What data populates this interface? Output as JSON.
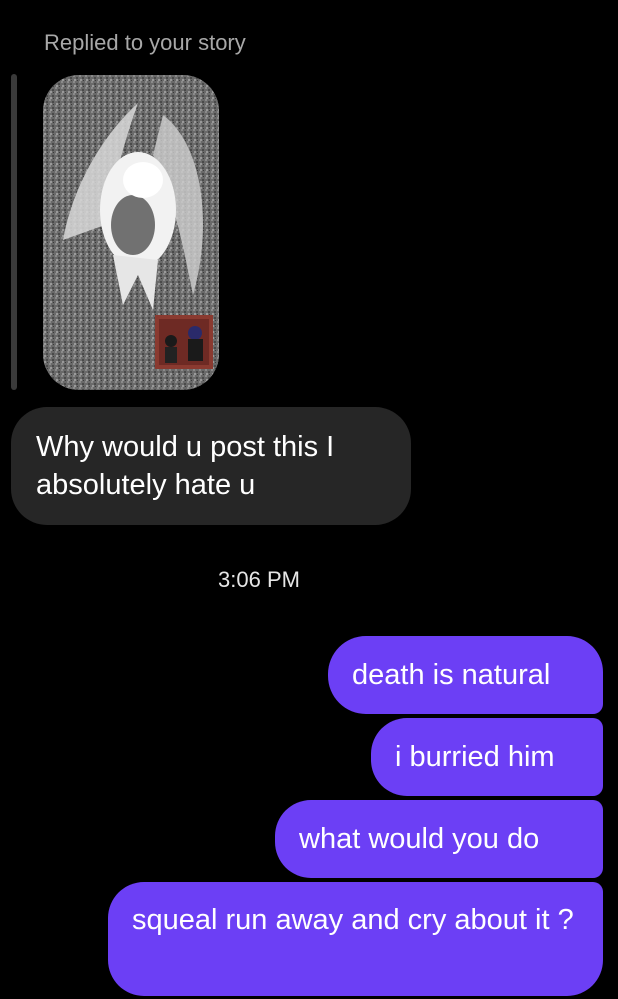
{
  "story_reply": {
    "header": "Replied to your story"
  },
  "messages": {
    "incoming_1": "Why would u post this I absolutely hate u",
    "timestamp": "3:06 PM",
    "outgoing_1": "death is natural",
    "outgoing_2": "i burried him",
    "outgoing_3": "what would you do",
    "outgoing_4": "squeal run away and cry about it ?"
  },
  "colors": {
    "background": "#000000",
    "incoming_bubble": "#262626",
    "outgoing_bubble": "#6c3ff5",
    "secondary_text": "#a8a8a8"
  }
}
